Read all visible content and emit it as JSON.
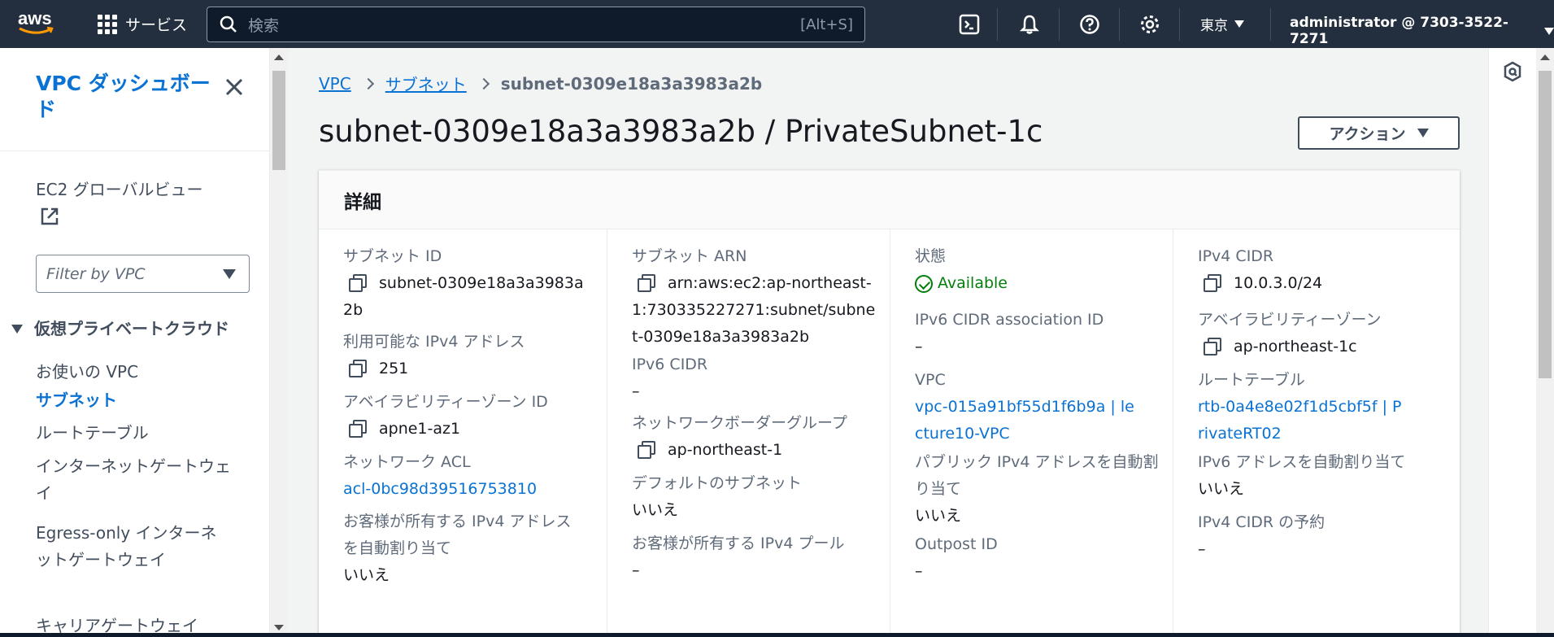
{
  "topnav": {
    "logo_text": "aws",
    "services_label": "サービス",
    "search_placeholder": "検索",
    "search_shortcut": "[Alt+S]",
    "region": "東京",
    "account": "administrator @ 7303-3522-7271",
    "icons": [
      "cloudshell-icon",
      "bell-icon",
      "help-icon",
      "settings-icon"
    ]
  },
  "sidebar": {
    "title": "VPC ダッシュボード",
    "ec2_global_view": "EC2 グローバルビュー",
    "filter_placeholder": "Filter by VPC",
    "section": "仮想プライベートクラウド",
    "items": [
      {
        "label": "お使いの VPC",
        "active": false
      },
      {
        "label": "サブネット",
        "active": true
      },
      {
        "label": "ルートテーブル",
        "active": false
      },
      {
        "label": "インターネットゲートウェイ",
        "active": false
      },
      {
        "label": "Egress-only インターネットゲートウェイ",
        "active": false
      },
      {
        "label": "キャリアゲートウェイ",
        "active": false
      }
    ]
  },
  "breadcrumb": {
    "items": [
      "VPC",
      "サブネット"
    ],
    "current": "subnet-0309e18a3a3983a2b"
  },
  "page": {
    "title": "subnet-0309e18a3a3983a2b / PrivateSubnet-1c",
    "actions_label": "アクション"
  },
  "details": {
    "heading": "詳細",
    "col1": [
      {
        "key": "サブネット ID",
        "value": "subnet-0309e18a3a3983a2b"
      },
      {
        "key": "利用可能な IPv4 アドレス",
        "value": "251"
      },
      {
        "key": "アベイラビリティーゾーン ID",
        "value": "apne1-az1"
      },
      {
        "key": "ネットワーク ACL",
        "value": "acl-0bc98d39516753810"
      },
      {
        "key": "お客様が所有する IPv4 アドレスを自動割り当て",
        "value": "いいえ"
      }
    ],
    "col2": [
      {
        "key": "サブネット ARN",
        "value": "arn:aws:ec2:ap-northeast-1:730335227271:subnet/subnet-0309e18a3a3983a2b"
      },
      {
        "key": "IPv6 CIDR",
        "value": "–"
      },
      {
        "key": "ネットワークボーダーグループ",
        "value": "ap-northeast-1"
      },
      {
        "key": "デフォルトのサブネット",
        "value": "いいえ"
      },
      {
        "key": "お客様が所有する IPv4 プール",
        "value": "–"
      }
    ],
    "col3": [
      {
        "key": "状態",
        "value": "Available"
      },
      {
        "key": "IPv6 CIDR association ID",
        "value": "–"
      },
      {
        "key": "VPC",
        "value": "vpc-015a91bf55d1f6b9a | lecture10-VPC"
      },
      {
        "key": "パブリック IPv4 アドレスを自動割り当て",
        "value": "いいえ"
      },
      {
        "key": "Outpost ID",
        "value": "–"
      }
    ],
    "col4": [
      {
        "key": "IPv4 CIDR",
        "value": "10.0.3.0/24"
      },
      {
        "key": "アベイラビリティーゾーン",
        "value": "ap-northeast-1c"
      },
      {
        "key": "ルートテーブル",
        "value": "rtb-0a4e8e02f1d5cbf5f | PrivateRT02"
      },
      {
        "key": "IPv6 アドレスを自動割り当て",
        "value": "いいえ"
      },
      {
        "key": "IPv4 CIDR の予約",
        "value": "–"
      }
    ]
  },
  "colors": {
    "nav_bg": "#232f3e",
    "link": "#0972d3",
    "success": "#037f0c"
  }
}
